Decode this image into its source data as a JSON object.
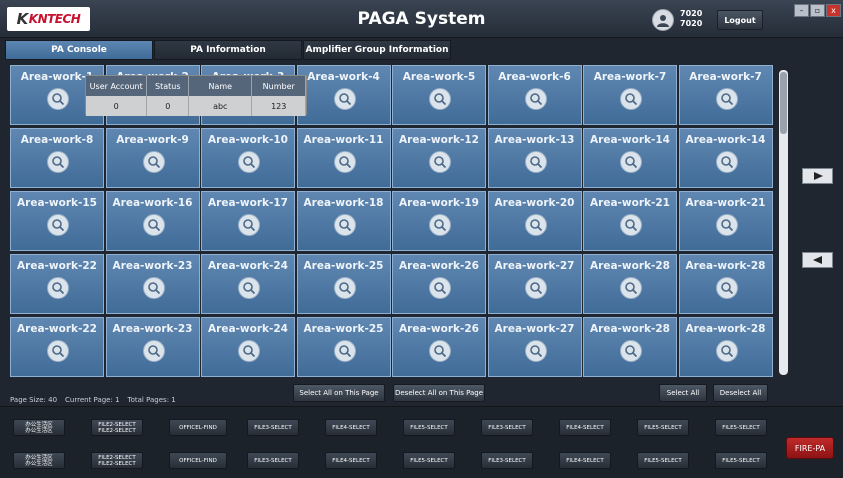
{
  "window": {
    "title": "PAGA System",
    "logo_text": "KNTECH",
    "user_line1": "7020",
    "user_line2": "7020",
    "logout_label": "Logout",
    "win_min": "–",
    "win_max": "▫",
    "win_close": "x"
  },
  "tabs": [
    {
      "label": "PA Console",
      "active": true
    },
    {
      "label": "PA Information",
      "active": false
    },
    {
      "label": "Amplifier Group Information",
      "active": false
    }
  ],
  "grid": {
    "rows": [
      [
        "Area-work-1",
        "Area-work-2",
        "Area-work-3",
        "Area-work-4",
        "Area-work-5",
        "Area-work-6",
        "Area-work-7",
        "Area-work-7"
      ],
      [
        "Area-work-8",
        "Area-work-9",
        "Area-work-10",
        "Area-work-11",
        "Area-work-12",
        "Area-work-13",
        "Area-work-14",
        "Area-work-14"
      ],
      [
        "Area-work-15",
        "Area-work-16",
        "Area-work-17",
        "Area-work-18",
        "Area-work-19",
        "Area-work-20",
        "Area-work-21",
        "Area-work-21"
      ],
      [
        "Area-work-22",
        "Area-work-23",
        "Area-work-24",
        "Area-work-25",
        "Area-work-26",
        "Area-work-27",
        "Area-work-28",
        "Area-work-28"
      ],
      [
        "Area-work-22",
        "Area-work-23",
        "Area-work-24",
        "Area-work-25",
        "Area-work-26",
        "Area-work-27",
        "Area-work-28",
        "Area-work-28"
      ]
    ]
  },
  "popup": {
    "headers": [
      "User Account",
      "Status",
      "Name",
      "Number"
    ],
    "values": [
      "0",
      "0",
      "abc",
      "123"
    ]
  },
  "paging": {
    "page_size": "Page Size: 40",
    "current_page": "Current Page: 1",
    "total_pages": "Total Pages: 1",
    "select_all_page": "Select  All on This Page",
    "deselect_all_page": "Deselect All on This Page",
    "select_all": "Select All",
    "deselect_all": "Deselect All"
  },
  "bottom": {
    "row1": [
      [
        "办公生活区",
        "办公生活区"
      ],
      [
        "FILE2-SELECT",
        "FILE2-SELECT"
      ],
      [
        "OFFICEL-FIND"
      ],
      [
        "FILE3-SELECT"
      ],
      [
        "FILE4-SELECT"
      ],
      [
        "FILE5-SELECT"
      ],
      [
        "FILE3-SELECT"
      ],
      [
        "FILE4-SELECT"
      ],
      [
        "FILE5-SELECT"
      ],
      [
        "FILE5-SELECT"
      ]
    ],
    "row2": [
      [
        "办公生活区",
        "办公生活区"
      ],
      [
        "FILE2-SELECT",
        "FILE2-SELECT"
      ],
      [
        "OFFICEL-FIND"
      ],
      [
        "FILE3-SELECT"
      ],
      [
        "FILE4-SELECT"
      ],
      [
        "FILE5-SELECT"
      ],
      [
        "FILE3-SELECT"
      ],
      [
        "FILE4-SELECT"
      ],
      [
        "FILE5-SELECT"
      ],
      [
        "FILE5-SELECT"
      ]
    ],
    "fire_label": "FIRE-PA"
  },
  "icons": {
    "area_icon": "search-icon",
    "next_icon": "play-right-icon",
    "prev_icon": "play-left-icon"
  }
}
